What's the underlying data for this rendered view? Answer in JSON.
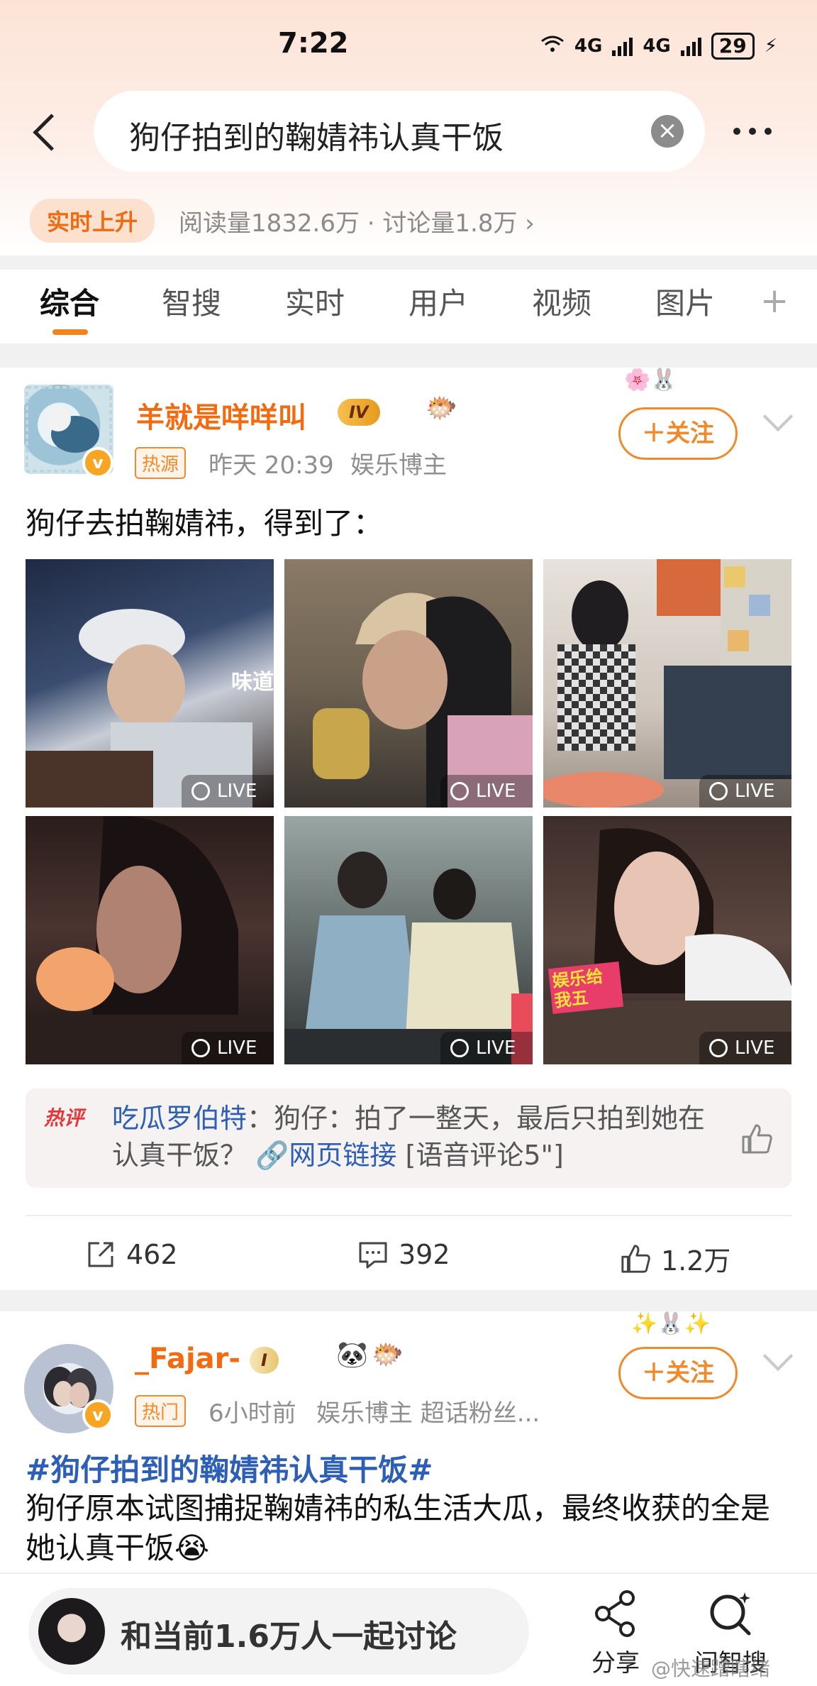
{
  "status_bar": {
    "time": "7:22",
    "net1": "6",
    "net2": "4G",
    "net3": "4G",
    "battery": "29"
  },
  "search": {
    "query": "狗仔拍到的鞠婧祎认真干饭",
    "clear_icon": "close-circle-icon"
  },
  "stats": {
    "badge": "实时上升",
    "line": "阅读量1832.6万 · 讨论量1.8万 ›"
  },
  "tabs": [
    {
      "label": "综合",
      "active": true
    },
    {
      "label": "智搜"
    },
    {
      "label": "实时"
    },
    {
      "label": "用户"
    },
    {
      "label": "视频"
    },
    {
      "label": "图片"
    }
  ],
  "tab_add": "+",
  "post1": {
    "username": "羊就是咩咩叫",
    "vip": "IV",
    "tag": "热源",
    "time": "昨天 20:39",
    "role": "娱乐博主",
    "follow": "＋关注",
    "text": "狗仔去拍鞠婧祎，得到了：",
    "live_label": "LIVE",
    "photo_overlays": {
      "p1": "味道",
      "p6": "娱乐给我五"
    },
    "hot_comment": {
      "badge": "热评",
      "user": "吃瓜罗伯特",
      "body": "：狗仔：拍了一整天，最后只拍到她在认真干饭？",
      "link": "🔗网页链接",
      "tail": " [语音评论5\"]"
    },
    "reposts": "462",
    "comments": "392",
    "likes": "1.2万"
  },
  "post2": {
    "username": "_Fajar-",
    "vip": "I",
    "tag": "热门",
    "time": "6小时前",
    "role": "娱乐博主 超话粉丝...",
    "follow": "＋关注",
    "topic": "#狗仔拍到的鞠婧祎认真干饭#",
    "text": "狗仔原本试图捕捉鞠婧祎的私生活大瓜，最终收获的全是她认真干饭😭"
  },
  "bottom": {
    "discuss": "和当前1.6万人一起讨论",
    "share": "分享",
    "ask": "问智搜",
    "watermark": "@快速蹭瞎绪"
  }
}
